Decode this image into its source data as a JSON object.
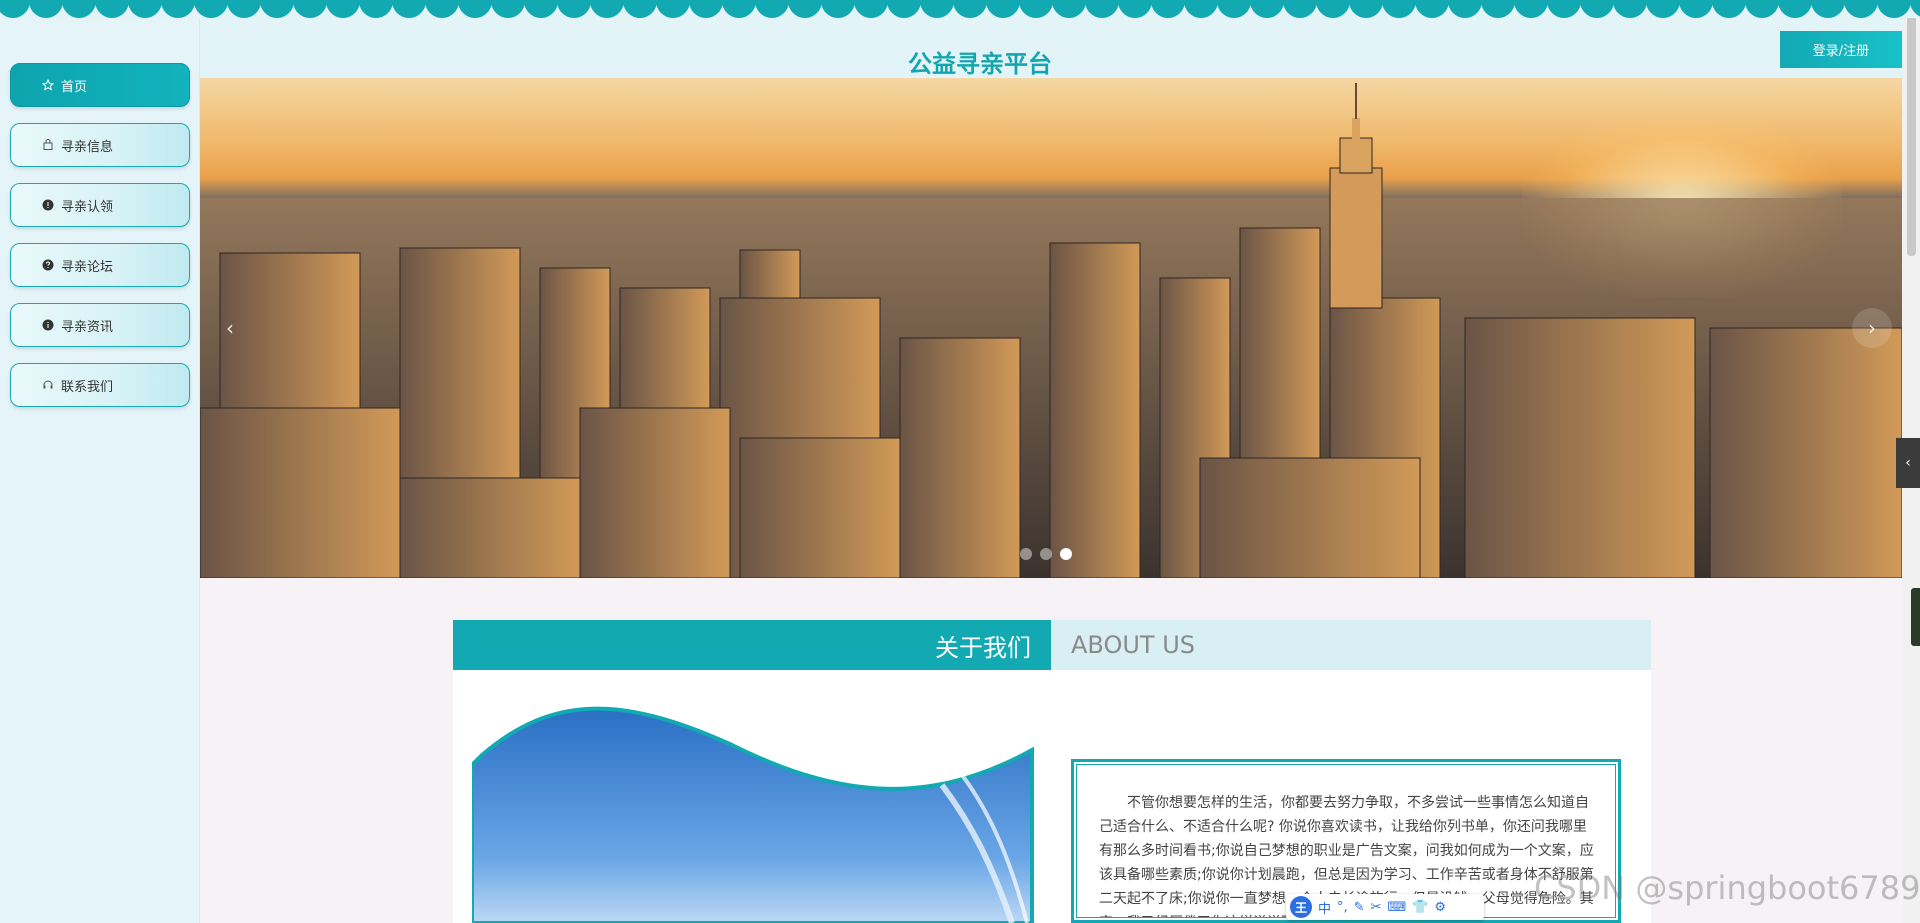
{
  "site": {
    "title": "公益寻亲平台",
    "login_label": "登录/注册"
  },
  "sidebar": {
    "items": [
      {
        "label": "首页",
        "icon": "star-icon",
        "active": true
      },
      {
        "label": "寻亲信息",
        "icon": "bag-icon",
        "active": false
      },
      {
        "label": "寻亲认领",
        "icon": "info-icon",
        "active": false
      },
      {
        "label": "寻亲论坛",
        "icon": "question-icon",
        "active": false
      },
      {
        "label": "寻亲资讯",
        "icon": "info-circle-icon",
        "active": false
      },
      {
        "label": "联系我们",
        "icon": "headset-icon",
        "active": false
      }
    ]
  },
  "banner": {
    "slide_count": 3,
    "active_slide": 3
  },
  "about": {
    "title_cn": "关于我们",
    "title_en": "ABOUT US",
    "text": "不管你想要怎样的生活，你都要去努力争取，不多尝试一些事情怎么知道自己适合什么、不适合什么呢? 你说你喜欢读书，让我给你列书单，你还问我哪里有那么多时间看书;你说自己梦想的职业是广告文案，问我如何成为一个文案，应该具备哪些素质;你说你计划晨跑，但总是因为学习、工作辛苦或者身体不舒服第二天起不了床;你说你一直梦想一个人去长途旅行，但是没钱，父母觉得危险。其实，我已经厌倦了你这样说说而已的把戏，我觉得就"
  },
  "overlay": {
    "ime_logo": "王",
    "ime_lang": "中",
    "watermark": "CSDN @springboot6789"
  },
  "colors": {
    "accent": "#12a9b3",
    "sidebar_bg": "#e4f4f8",
    "page_bg": "#f6f2f5"
  }
}
